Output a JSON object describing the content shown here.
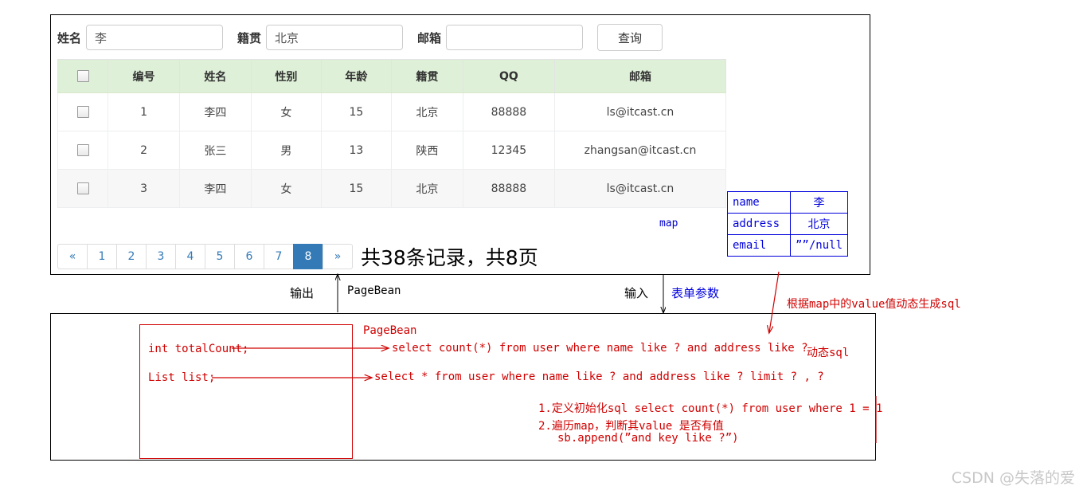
{
  "search": {
    "name_label": "姓名",
    "name_value": "李",
    "name_placeholder": "",
    "address_label": "籍贯",
    "address_value": "北京",
    "address_placeholder": "",
    "email_label": "邮箱",
    "email_value": "",
    "email_placeholder": "",
    "query_label": "查询"
  },
  "table": {
    "headers": [
      "",
      "编号",
      "姓名",
      "性别",
      "年龄",
      "籍贯",
      "QQ",
      "邮箱"
    ],
    "rows": [
      {
        "id": "1",
        "name": "李四",
        "gender": "女",
        "age": "15",
        "address": "北京",
        "qq": "88888",
        "email": "ls@itcast.cn"
      },
      {
        "id": "2",
        "name": "张三",
        "gender": "男",
        "age": "13",
        "address": "陕西",
        "qq": "12345",
        "email": "zhangsan@itcast.cn"
      },
      {
        "id": "3",
        "name": "李四",
        "gender": "女",
        "age": "15",
        "address": "北京",
        "qq": "88888",
        "email": "ls@itcast.cn"
      }
    ]
  },
  "pagination": {
    "prev": "«",
    "pages": [
      "1",
      "2",
      "3",
      "4",
      "5",
      "6",
      "7",
      "8"
    ],
    "active_page": "8",
    "next": "»",
    "summary": "共38条记录，共8页"
  },
  "map_annotation": {
    "label": "map",
    "rows": [
      {
        "key": "name",
        "value": "李"
      },
      {
        "key": "address",
        "value": "北京"
      },
      {
        "key": "email",
        "value": "””/null"
      }
    ]
  },
  "middle": {
    "output_label": "输出",
    "output_type": "PageBean",
    "input_label": "输入",
    "input_type": "表单参数",
    "red_note": "根据map中的value值动态生成sql"
  },
  "bottom": {
    "pagebean_title": "PageBean",
    "field_total": "int totalCount;",
    "field_list": "List list;",
    "sql_count": "select count(*) from user where name like ? and address like ?",
    "sql_list": "select * from user where name like ? and address like ? limit ? , ?",
    "dynamic_sql_label": "动态sql",
    "note_line1": "1.定义初始化sql select count(*) from user where 1 = 1",
    "note_line2": "2.遍历map，判断其value 是否有值",
    "note_line3": "sb.append(”and  key like ?”)"
  },
  "watermark": "CSDN @失落的爱",
  "colors": {
    "accent_blue": "#337ab7",
    "table_header_green": "#dff0d8",
    "annotation_red": "#d00000",
    "annotation_blue": "#0000dd"
  }
}
